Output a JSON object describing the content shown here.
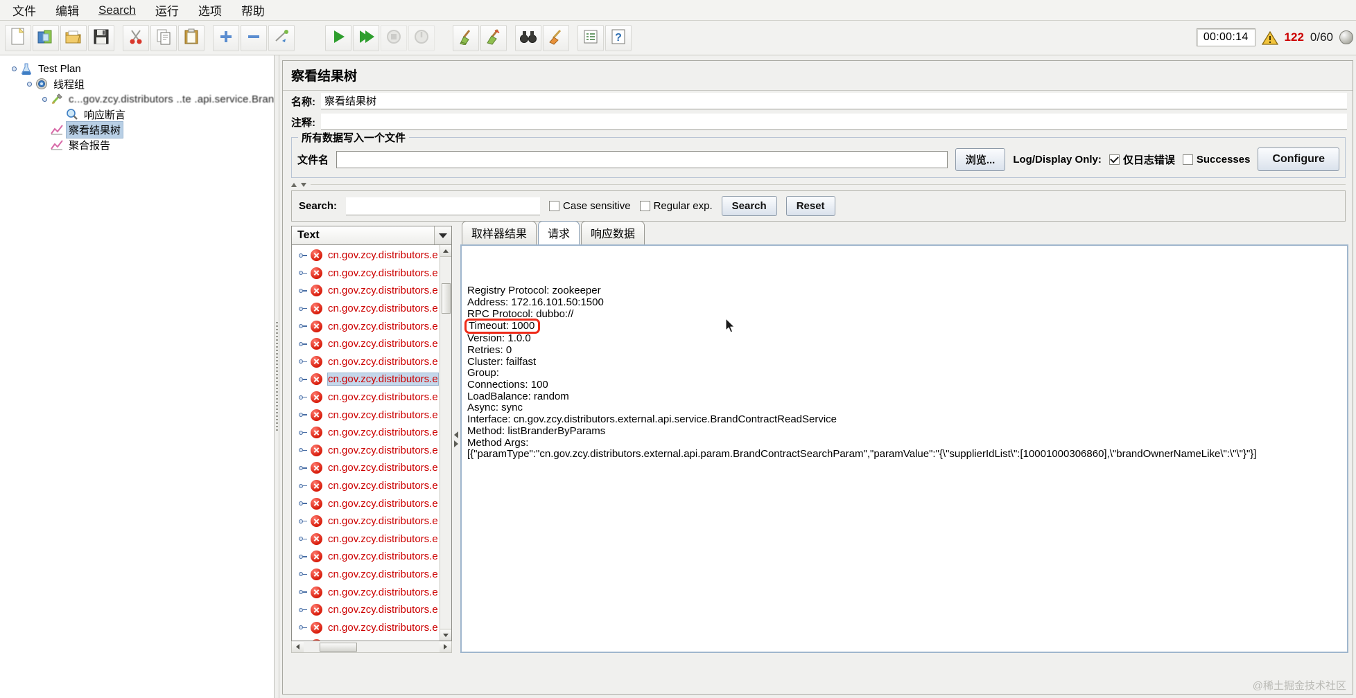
{
  "menu": {
    "items": [
      {
        "label": "文件",
        "mnemonic": ""
      },
      {
        "label": "编辑",
        "mnemonic": ""
      },
      {
        "label": "Search",
        "mnemonic": "S"
      },
      {
        "label": "运行",
        "mnemonic": ""
      },
      {
        "label": "选项",
        "mnemonic": ""
      },
      {
        "label": "帮助",
        "mnemonic": ""
      }
    ]
  },
  "toolbar": {
    "buttons": [
      {
        "name": "new-icon",
        "tip": "新建"
      },
      {
        "name": "templates-icon",
        "tip": "模板"
      },
      {
        "name": "open-icon",
        "tip": "打开"
      },
      {
        "name": "save-icon",
        "tip": "保存"
      },
      {
        "name": "cut-icon",
        "tip": "剪切"
      },
      {
        "name": "copy-icon",
        "tip": "复制"
      },
      {
        "name": "paste-icon",
        "tip": "粘贴"
      },
      {
        "name": "expand-icon",
        "tip": "展开"
      },
      {
        "name": "collapse-icon",
        "tip": "折叠"
      },
      {
        "name": "toggle-icon",
        "tip": "启用/禁用"
      },
      {
        "name": "start-icon",
        "tip": "启动"
      },
      {
        "name": "start-no-pause-icon",
        "tip": "无间隔启动"
      },
      {
        "name": "stop-icon",
        "tip": "停止"
      },
      {
        "name": "shutdown-icon",
        "tip": "关闭"
      },
      {
        "name": "clear-icon",
        "tip": "清除"
      },
      {
        "name": "clear-all-icon",
        "tip": "清除全部"
      },
      {
        "name": "search-icon",
        "tip": "搜索"
      },
      {
        "name": "reset-search-icon",
        "tip": "重置搜索"
      },
      {
        "name": "function-helper-icon",
        "tip": "函数助手"
      },
      {
        "name": "help-icon",
        "tip": "帮助"
      }
    ]
  },
  "status": {
    "timer": "00:00:14",
    "warning_icon": "warning-triangle-icon",
    "error_count": "122",
    "threads": "0/60",
    "error_color": "#cc0000"
  },
  "tree": {
    "nodes": [
      {
        "label": "Test Plan",
        "icon": "test-plan-icon",
        "depth": 0,
        "selected": false,
        "blurred": false
      },
      {
        "label": "线程组",
        "icon": "thread-group-icon",
        "depth": 1,
        "selected": false,
        "blurred": false
      },
      {
        "label": "c...gov.zcy.distributors    ..te       .api.service.Bran",
        "icon": "sampler-icon",
        "depth": 2,
        "selected": false,
        "blurred": true
      },
      {
        "label": "响应断言",
        "icon": "assertion-icon",
        "depth": 3,
        "selected": false,
        "blurred": false
      },
      {
        "label": "察看结果树",
        "icon": "view-results-tree-icon",
        "depth": 2,
        "selected": true,
        "blurred": false
      },
      {
        "label": "聚合报告",
        "icon": "aggregate-report-icon",
        "depth": 2,
        "selected": false,
        "blurred": false
      }
    ]
  },
  "panel": {
    "title": "察看结果树",
    "name_label": "名称:",
    "name_value": "察看结果树",
    "comment_label": "注释:",
    "comment_value": "",
    "group_legend": "所有数据写入一个文件",
    "filename_label": "文件名",
    "filename_value": "",
    "browse_button": "浏览...",
    "log_display_label": "Log/Display Only:",
    "errors_only_label": "仅日志错误",
    "errors_only_checked": true,
    "successes_label": "Successes",
    "successes_checked": false,
    "configure_button": "Configure"
  },
  "search": {
    "label": "Search:",
    "value": "",
    "case_sensitive_label": "Case sensitive",
    "case_sensitive_checked": false,
    "regex_label": "Regular exp.",
    "regex_checked": false,
    "search_button": "Search",
    "reset_button": "Reset"
  },
  "render": {
    "selected": "Text"
  },
  "result_list": {
    "entry_label": "cn.gov.zcy.distributors.e",
    "entry_label_truncated": "cn.gov.zcy.distributors.e",
    "count": 23,
    "selected_index": 7,
    "status_icon": "error-circle-icon",
    "text_color": "#cc0000"
  },
  "tabs": [
    {
      "label": "取样器结果",
      "active": false
    },
    {
      "label": "请求",
      "active": true
    },
    {
      "label": "响应数据",
      "active": false
    }
  ],
  "request_detail": {
    "lines": [
      "Registry Protocol: zookeeper",
      "Address: 172.16.101.50:1500",
      "RPC Protocol: dubbo://",
      "Timeout: 1000",
      "Version: 1.0.0",
      "Retries: 0",
      "Cluster: failfast",
      "Group:",
      "Connections: 100",
      "LoadBalance: random",
      "Async: sync",
      "Interface: cn.gov.zcy.distributors.external.api.service.BrandContractReadService",
      "Method: listBranderByParams",
      "Method Args:",
      "[{\"paramType\":\"cn.gov.zcy.distributors.external.api.param.BrandContractSearchParam\",\"paramValue\":\"{\\\"supplierIdList\\\":[10001000306860],\\\"brandOwnerNameLike\\\":\\\"\\\"}\"}]"
    ],
    "highlighted_line_index": 3,
    "highlight_color": "#ee2b19"
  },
  "watermark": "@稀土掘金技术社区"
}
